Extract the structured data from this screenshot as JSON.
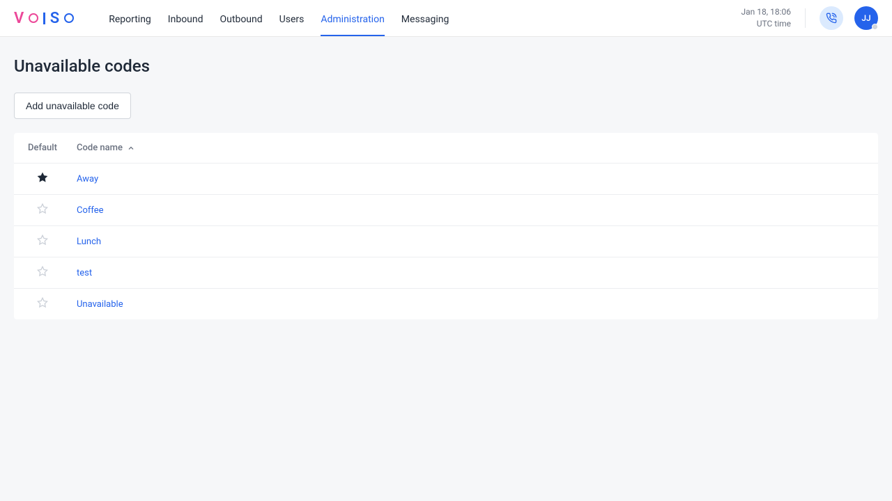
{
  "header": {
    "nav": [
      {
        "label": "Reporting",
        "active": false
      },
      {
        "label": "Inbound",
        "active": false
      },
      {
        "label": "Outbound",
        "active": false
      },
      {
        "label": "Users",
        "active": false
      },
      {
        "label": "Administration",
        "active": true
      },
      {
        "label": "Messaging",
        "active": false
      }
    ],
    "datetime": "Jan 18, 18:06",
    "timezone": "UTC time",
    "avatar_initials": "JJ"
  },
  "page": {
    "title": "Unavailable codes",
    "add_button_label": "Add unavailable code"
  },
  "table": {
    "columns": {
      "default": "Default",
      "code_name": "Code name"
    },
    "rows": [
      {
        "default": true,
        "name": "Away"
      },
      {
        "default": false,
        "name": "Coffee"
      },
      {
        "default": false,
        "name": "Lunch"
      },
      {
        "default": false,
        "name": "test"
      },
      {
        "default": false,
        "name": "Unavailable"
      }
    ]
  }
}
